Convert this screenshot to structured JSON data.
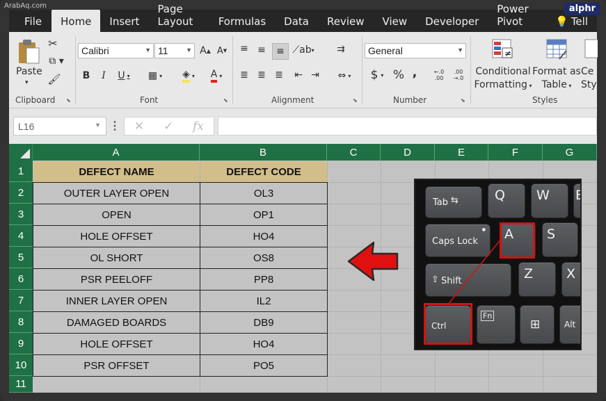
{
  "watermark": "ArabAq.com",
  "brand": "alphr",
  "tabs": [
    "File",
    "Home",
    "Insert",
    "Page Layout",
    "Formulas",
    "Data",
    "Review",
    "View",
    "Developer",
    "Power Pivot",
    "Tell"
  ],
  "active_tab": "Home",
  "ribbon": {
    "clipboard": {
      "paste_label": "Paste",
      "group_label": "Clipboard"
    },
    "font": {
      "family": "Calibri",
      "size": "11",
      "bold": "B",
      "italic": "I",
      "underline": "U",
      "grow": "A",
      "shrink": "A",
      "font_color_letter": "A",
      "group_label": "Font"
    },
    "alignment": {
      "group_label": "Alignment"
    },
    "number": {
      "format": "General",
      "currency": "$",
      "percent": "%",
      "comma": ",",
      "inc_decimal": "←.0\n.00",
      "dec_decimal": ".00\n→.0",
      "group_label": "Number"
    },
    "styles": {
      "conditional_formatting": [
        "Conditional",
        "Formatting"
      ],
      "format_as_table": [
        "Format as",
        "Table"
      ],
      "cell_styles": [
        "Ce",
        "Styl"
      ],
      "group_label": "Styles"
    }
  },
  "formula_bar": {
    "name_box": "L16",
    "cancel_icon": "✕",
    "enter_icon": "✓",
    "fx": "fx",
    "formula": ""
  },
  "columns": [
    "A",
    "B",
    "C",
    "D",
    "E",
    "F",
    "G"
  ],
  "rows": [
    "1",
    "2",
    "3",
    "4",
    "5",
    "6",
    "7",
    "8",
    "9",
    "10",
    "11"
  ],
  "table": {
    "headers": [
      "DEFECT NAME",
      "DEFECT CODE"
    ],
    "rows": [
      [
        "OUTER LAYER OPEN",
        "OL3"
      ],
      [
        "OPEN",
        "OP1"
      ],
      [
        "HOLE OFFSET",
        "HO4"
      ],
      [
        "OL SHORT",
        "OS8"
      ],
      [
        "PSR PEELOFF",
        "PP8"
      ],
      [
        "INNER LAYER OPEN",
        "IL2"
      ],
      [
        "DAMAGED BOARDS",
        "DB9"
      ],
      [
        "HOLE OFFSET",
        "HO4"
      ],
      [
        "PSR OFFSET",
        "PO5"
      ]
    ]
  },
  "keyboard": {
    "keys": [
      "Tab",
      "Q",
      "W",
      "E",
      "Caps Lock",
      "A",
      "S",
      "Shift",
      "Z",
      "X",
      "Ctrl",
      "Fn",
      "Alt"
    ],
    "highlighted": [
      "Ctrl",
      "A"
    ]
  },
  "colors": {
    "header_green": "#1f7044",
    "table_header_fill": "#d2be8a",
    "highlight_red": "#d01414",
    "arrow_red": "#e01010"
  }
}
